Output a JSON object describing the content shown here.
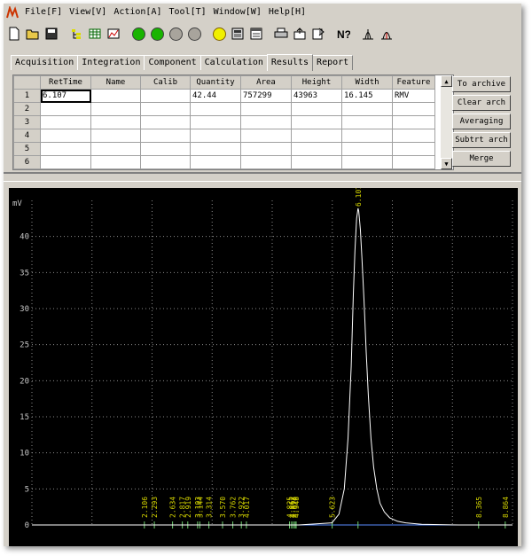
{
  "menu": [
    "File[F]",
    "View[V]",
    "Action[A]",
    "Tool[T]",
    "Window[W]",
    "Help[H]"
  ],
  "toolbar": {
    "icons": [
      "new-file-icon",
      "open-folder-icon",
      "save-icon",
      "tree-icon",
      "grid-icon",
      "chart-icon",
      "green-circle-icon",
      "green-circle-icon",
      "gray-circle-icon",
      "gray-circle-icon",
      "bulb-icon",
      "calculator-icon",
      "calendar-icon",
      "print-icon",
      "export-icon",
      "import-icon",
      "help-icon",
      "peak-icon",
      "peak-split-icon"
    ]
  },
  "tabs": [
    "Acquisition",
    "Integration",
    "Component",
    "Calculation",
    "Results",
    "Report"
  ],
  "active_tab": "Results",
  "results": {
    "columns": [
      "RetTime",
      "Name",
      "Calib",
      "Quantity",
      "Area",
      "Height",
      "Width",
      "Feature"
    ],
    "rows": [
      {
        "num": "1",
        "cells": [
          "6.107",
          "",
          "",
          "42.44",
          "757299",
          "43963",
          "16.145",
          "RMV"
        ]
      },
      {
        "num": "2",
        "cells": [
          "",
          "",
          "",
          "",
          "",
          "",
          "",
          ""
        ]
      },
      {
        "num": "3",
        "cells": [
          "",
          "",
          "",
          "",
          "",
          "",
          "",
          ""
        ]
      },
      {
        "num": "4",
        "cells": [
          "",
          "",
          "",
          "",
          "",
          "",
          "",
          ""
        ]
      },
      {
        "num": "5",
        "cells": [
          "",
          "",
          "",
          "",
          "",
          "",
          "",
          ""
        ]
      },
      {
        "num": "6",
        "cells": [
          "",
          "",
          "",
          "",
          "",
          "",
          "",
          ""
        ]
      }
    ]
  },
  "side_buttons": [
    "To archive",
    "Clear arch",
    "Averaging",
    "Subtrt arch",
    "Merge"
  ],
  "chart_data": {
    "type": "line",
    "ylabel": "mV",
    "ylim": [
      0,
      45
    ],
    "xlim": [
      0,
      9.0
    ],
    "yticks": [
      "40",
      "35",
      "30",
      "25",
      "20",
      "15",
      "10",
      "5",
      "0"
    ],
    "series": [
      {
        "x": [
          0,
          5.0,
          5.62,
          5.75,
          5.85,
          5.92,
          5.98,
          6.02,
          6.05,
          6.08,
          6.107,
          6.12,
          6.15,
          6.18,
          6.22,
          6.26,
          6.3,
          6.35,
          6.4,
          6.46,
          6.52,
          6.6,
          6.7,
          6.85,
          7.0,
          7.3,
          8.0,
          9.0
        ],
        "values": [
          0,
          0,
          0.3,
          1.5,
          5,
          12,
          22,
          32,
          38,
          42.5,
          43.9,
          43.5,
          41,
          37,
          31,
          24,
          18,
          12,
          8,
          5,
          3,
          1.8,
          1,
          0.5,
          0.3,
          0.1,
          0,
          0
        ]
      }
    ],
    "peak_labels": [
      "2.106",
      "2.293",
      "2.634",
      "2.817",
      "2.919",
      "3.103",
      "3.144",
      "3.314",
      "3.570",
      "3.762",
      "3.922",
      "4.017",
      "4.825",
      "4.862",
      "4.893",
      "4.926",
      "4.948",
      "5.623",
      "6.107",
      "8.365",
      "8.864"
    ],
    "peak_positions": [
      2.106,
      2.293,
      2.634,
      2.817,
      2.919,
      3.103,
      3.144,
      3.314,
      3.57,
      3.762,
      3.922,
      4.017,
      4.825,
      4.862,
      4.893,
      4.926,
      4.948,
      5.623,
      6.107,
      8.365,
      8.864
    ],
    "trace_color": "#ffffff",
    "label_color": "#d8d800",
    "grid_color": "#8a8a8a"
  }
}
